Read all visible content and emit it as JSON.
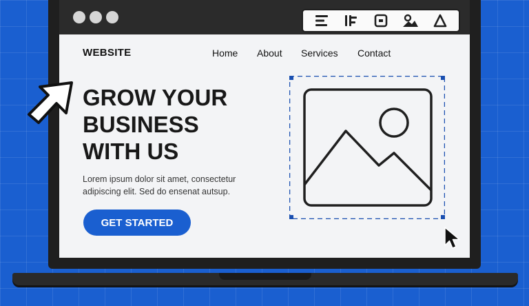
{
  "window": {
    "controls": [
      "window-dot",
      "window-dot",
      "window-dot"
    ]
  },
  "toolbar": {
    "tools": [
      {
        "name": "align-left-icon"
      },
      {
        "name": "align-center-icon"
      },
      {
        "name": "box-icon"
      },
      {
        "name": "image-icon"
      },
      {
        "name": "triangle-icon"
      }
    ]
  },
  "site": {
    "brand": "WEBSITE",
    "nav": [
      "Home",
      "About",
      "Services",
      "Contact"
    ]
  },
  "hero": {
    "title_lines": [
      "GROW YOUR",
      "BUSINESS",
      "WITH US"
    ],
    "body_lines": [
      "Lorem ipsum dolor sit amet, consectetur",
      "adipiscing elit. Sed do ensenat autsup."
    ],
    "cta_label": "GET STARTED"
  },
  "colors": {
    "accent": "#1a5fd0",
    "selection": "#1a4fb0",
    "dark": "#1f1f1f",
    "screen_bg": "#f3f4f6"
  }
}
